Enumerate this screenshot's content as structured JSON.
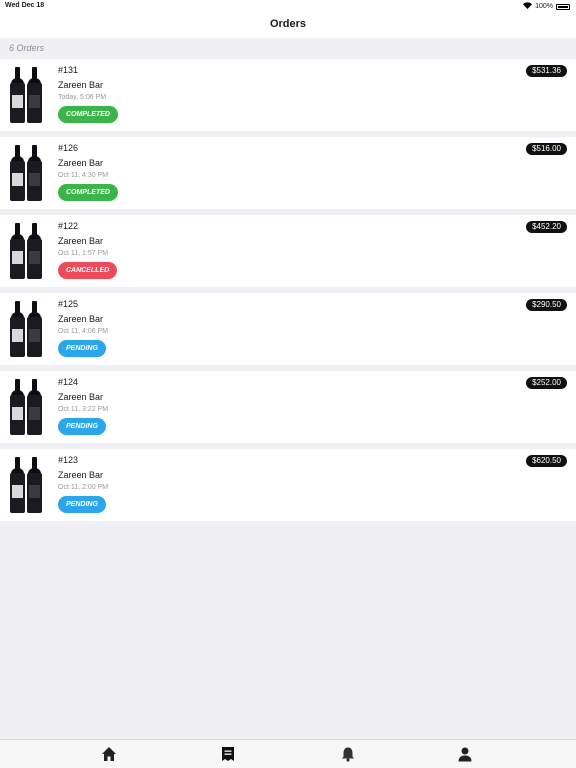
{
  "status_bar": {
    "time": "Wed Dec 18",
    "battery": "100%"
  },
  "nav": {
    "title": "Orders"
  },
  "orders_count": "6 Orders",
  "orders": [
    {
      "number": "#131",
      "venue": "Zareen Bar",
      "time": "Today, 5:06 PM",
      "status": "COMPLETED",
      "status_class": "completed",
      "price": "$531.36"
    },
    {
      "number": "#126",
      "venue": "Zareen Bar",
      "time": "Oct 11, 4:30 PM",
      "status": "COMPLETED",
      "status_class": "completed",
      "price": "$516.00"
    },
    {
      "number": "#122",
      "venue": "Zareen Bar",
      "time": "Oct 11, 1:57 PM",
      "status": "CANCELLED",
      "status_class": "cancelled",
      "price": "$452.20"
    },
    {
      "number": "#125",
      "venue": "Zareen Bar",
      "time": "Oct 11, 4:06 PM",
      "status": "PENDING",
      "status_class": "pending",
      "price": "$290.50"
    },
    {
      "number": "#124",
      "venue": "Zareen Bar",
      "time": "Oct 11, 3:22 PM",
      "status": "PENDING",
      "status_class": "pending",
      "price": "$252.00"
    },
    {
      "number": "#123",
      "venue": "Zareen Bar",
      "time": "Oct 11, 2:00 PM",
      "status": "PENDING",
      "status_class": "pending",
      "price": "$620.50"
    }
  ],
  "colors": {
    "completed": "#3bb54a",
    "cancelled": "#ef4a5a",
    "pending": "#2ba6ea",
    "price_bg": "#111111"
  },
  "tab_bar": {
    "items": [
      {
        "icon": "home-icon"
      },
      {
        "icon": "orders-icon"
      },
      {
        "icon": "bell-icon"
      },
      {
        "icon": "profile-icon"
      }
    ]
  }
}
